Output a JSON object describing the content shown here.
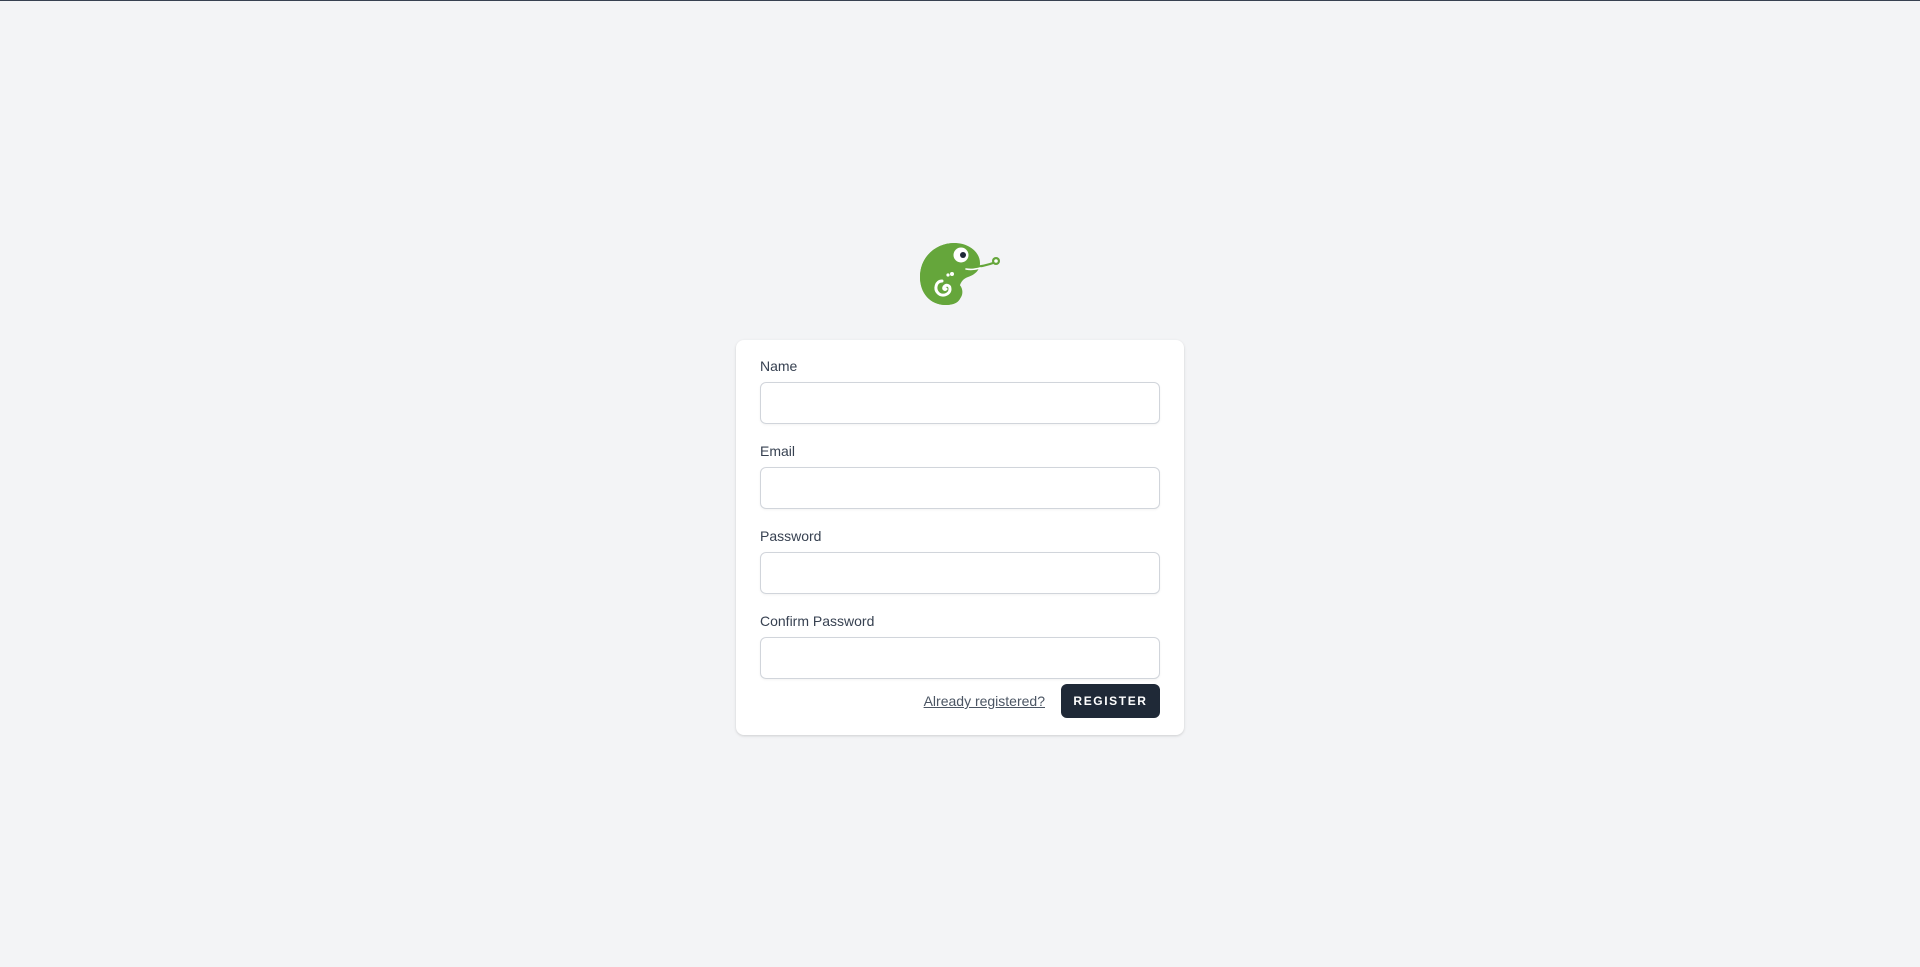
{
  "logo": {
    "icon": "chameleon-logo-icon",
    "color": "#65a63b"
  },
  "form": {
    "fields": [
      {
        "label": "Name",
        "value": "",
        "placeholder": ""
      },
      {
        "label": "Email",
        "value": "",
        "placeholder": ""
      },
      {
        "label": "Password",
        "value": "",
        "placeholder": ""
      },
      {
        "label": "Confirm Password",
        "value": "",
        "placeholder": ""
      }
    ],
    "login_link": "Already registered?",
    "submit_label": "REGISTER"
  },
  "colors": {
    "background": "#f3f4f6",
    "card": "#ffffff",
    "button": "#1f2937",
    "brand": "#65a63b"
  }
}
